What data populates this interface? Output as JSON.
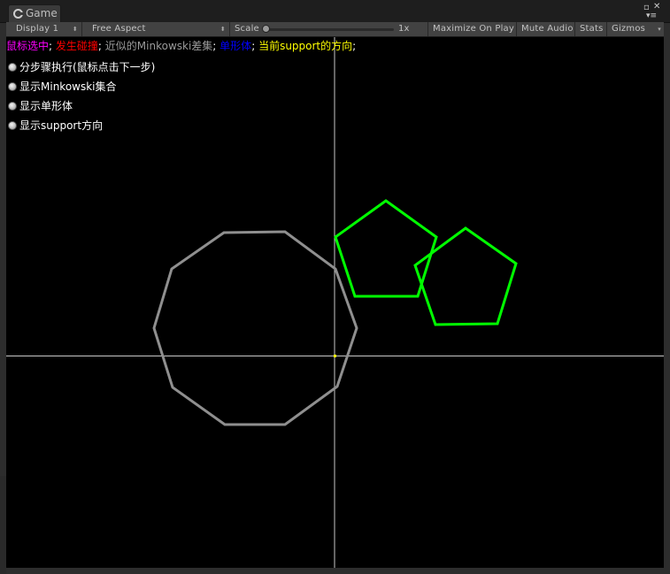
{
  "window": {
    "tab_label": "Game"
  },
  "toolbar": {
    "display": "Display 1",
    "aspect": "Free Aspect",
    "scale_label": "Scale",
    "scale_value": "1x",
    "scale_fraction": 0.0,
    "maximize": "Maximize On Play",
    "mute": "Mute Audio",
    "stats": "Stats",
    "gizmos": "Gizmos"
  },
  "legend": {
    "selected": "鼠标选中",
    "sep1": ";",
    "collision": "发生碰撞",
    "sep2": ";",
    "minkowski": "近似的Minkowski差集",
    "sep3": ";",
    "simplex": "单形体",
    "sep4": ";",
    "support": "当前support的方向",
    "sep5": ";",
    "colors": {
      "selected": "#ff00ff",
      "collision": "#ff0000",
      "minkowski": "#9a9a9a",
      "simplex": "#0000ff",
      "support": "#ffff00",
      "separator": "#ffffff"
    }
  },
  "toggles": [
    {
      "label": "分步骤执行(鼠标点击下一步)"
    },
    {
      "label": "显示Minkowski集合"
    },
    {
      "label": "显示单形体"
    },
    {
      "label": "显示support方向"
    }
  ],
  "scene": {
    "axis_color": "#c8c8c8",
    "decagon_color": "#8f8f8f",
    "pentagon_color": "#00ff00",
    "origin_color": "#ffff00"
  }
}
